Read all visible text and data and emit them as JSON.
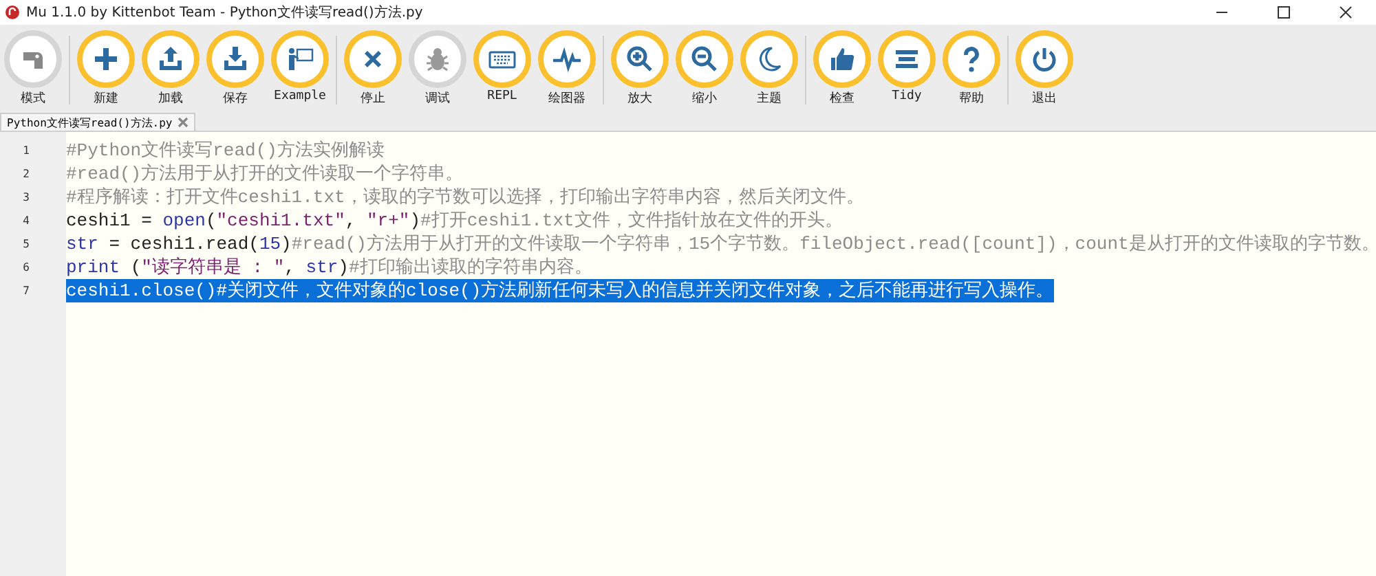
{
  "window": {
    "title": "Mu 1.1.0 by Kittenbot Team - Python文件读写read()方法.py"
  },
  "toolbar_groups": [
    [
      {
        "label": "模式",
        "disabled": true
      }
    ],
    [
      {
        "label": "新建",
        "disabled": false
      },
      {
        "label": "加载",
        "disabled": false
      },
      {
        "label": "保存",
        "disabled": false
      },
      {
        "label": "Example",
        "disabled": false
      }
    ],
    [
      {
        "label": "停止",
        "disabled": false
      },
      {
        "label": "调试",
        "disabled": true
      },
      {
        "label": "REPL",
        "disabled": false
      },
      {
        "label": "绘图器",
        "disabled": false
      }
    ],
    [
      {
        "label": "放大",
        "disabled": false
      },
      {
        "label": "缩小",
        "disabled": false
      },
      {
        "label": "主题",
        "disabled": false
      }
    ],
    [
      {
        "label": "检查",
        "disabled": false
      },
      {
        "label": "Tidy",
        "disabled": false
      },
      {
        "label": "帮助",
        "disabled": false
      }
    ],
    [
      {
        "label": "退出",
        "disabled": false
      }
    ]
  ],
  "tabs": [
    {
      "label": "Python文件读写read()方法.py",
      "selected": true
    }
  ],
  "editor": {
    "lines": [
      {
        "number": "1",
        "selected": false,
        "tokens": [
          {
            "kind": "comment",
            "text": "#Python文件读写read()方法实例解读"
          }
        ]
      },
      {
        "number": "2",
        "selected": false,
        "tokens": [
          {
            "kind": "comment",
            "text": "#read()方法用于从打开的文件读取一个字符串。"
          }
        ]
      },
      {
        "number": "3",
        "selected": false,
        "tokens": [
          {
            "kind": "comment",
            "text": "#程序解读：打开文件ceshi1.txt，读取的字节数可以选择，打印输出字符串内容，然后关闭文件。"
          }
        ]
      },
      {
        "number": "4",
        "selected": false,
        "tokens": [
          {
            "kind": "plain",
            "text": "ceshi1 = "
          },
          {
            "kind": "builtin",
            "text": "open"
          },
          {
            "kind": "plain",
            "text": "("
          },
          {
            "kind": "string",
            "text": "\"ceshi1.txt\""
          },
          {
            "kind": "plain",
            "text": ", "
          },
          {
            "kind": "string",
            "text": "\"r+\""
          },
          {
            "kind": "plain",
            "text": ")"
          },
          {
            "kind": "comment",
            "text": "#打开ceshi1.txt文件，文件指针放在文件的开头。"
          }
        ]
      },
      {
        "number": "5",
        "selected": false,
        "tokens": [
          {
            "kind": "builtin",
            "text": "str"
          },
          {
            "kind": "plain",
            "text": " = ceshi1.read("
          },
          {
            "kind": "number",
            "text": "15"
          },
          {
            "kind": "plain",
            "text": ")"
          },
          {
            "kind": "comment",
            "text": "#read()方法用于从打开的文件读取一个字符串，15个字节数。fileObject.read([count])，count是从打开的文件读取的字节数。"
          }
        ]
      },
      {
        "number": "6",
        "selected": false,
        "tokens": [
          {
            "kind": "builtin",
            "text": "print"
          },
          {
            "kind": "plain",
            "text": " ("
          },
          {
            "kind": "string",
            "text": "\"读字符串是 : \""
          },
          {
            "kind": "plain",
            "text": ", "
          },
          {
            "kind": "builtin",
            "text": "str"
          },
          {
            "kind": "plain",
            "text": ")"
          },
          {
            "kind": "comment",
            "text": "#打印输出读取的字符串内容。"
          }
        ]
      },
      {
        "number": "7",
        "selected": true,
        "tokens": [
          {
            "kind": "plain",
            "text": "ceshi1.close()"
          },
          {
            "kind": "comment",
            "text": "#关闭文件，文件对象的close()方法刷新任何未写入的信息并关闭文件对象，之后不能再进行写入操作。"
          }
        ]
      }
    ]
  }
}
